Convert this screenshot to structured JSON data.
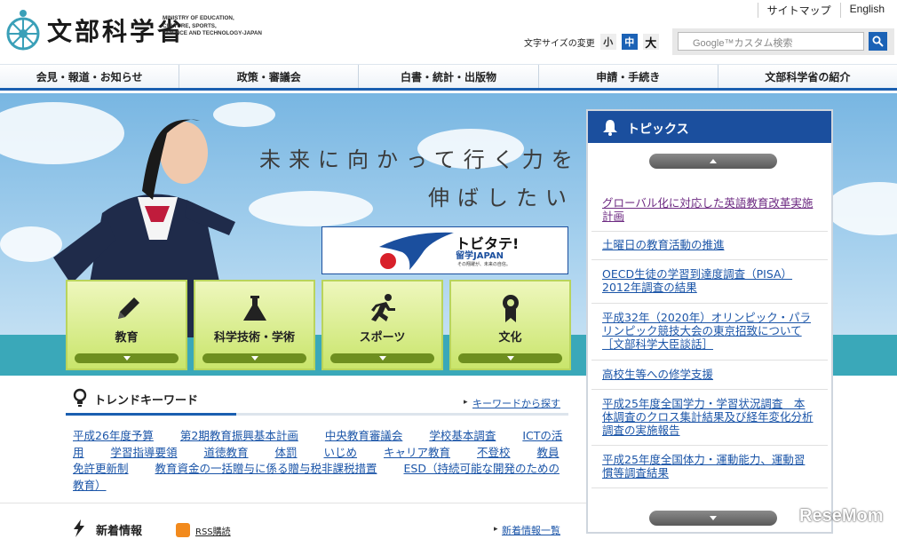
{
  "header": {
    "logo_text": "文部科学省",
    "logo_en": [
      "MINISTRY OF EDUCATION,",
      "CULTURE, SPORTS,",
      "SCIENCE AND TECHNOLOGY-JAPAN"
    ],
    "links": [
      "サイトマップ",
      "English"
    ],
    "font_size_label": "文字サイズの変更",
    "font_sizes": [
      "小",
      "中",
      "大"
    ],
    "search_placeholder": "Google™カスタム検索"
  },
  "nav": [
    "会見・報道・お知らせ",
    "政策・審議会",
    "白書・統計・出版物",
    "申請・手続き",
    "文部科学省の紹介"
  ],
  "hero": {
    "slogan_line1": "未来に向かって行く力を",
    "slogan_line2": "伸ばしたい",
    "banner_title": "トビタテ!",
    "banner_sub": "留学JAPAN",
    "banner_tag": "その翔躍が、未来の自信。"
  },
  "categories": [
    "教育",
    "科学技術・学術",
    "スポーツ",
    "文化"
  ],
  "trends": {
    "title": "トレンドキーワード",
    "more": "キーワードから探す",
    "keywords": [
      "平成26年度予算",
      "第2期教育振興基本計画",
      "中央教育審議会",
      "学校基本調査",
      "ICTの活用",
      "学習指導要領",
      "道徳教育",
      "体罰",
      "いじめ",
      "キャリア教育",
      "不登校",
      "教員免許更新制",
      "教育資金の一括贈与に係る贈与税非課税措置",
      "ESD（持続可能な開発のための教育）"
    ]
  },
  "news": {
    "title": "新着情報",
    "rss": "RSS購読",
    "more": "新着情報一覧"
  },
  "topics": {
    "title": "トピックス",
    "items": [
      "グローバル化に対応した英語教育改革実施計画",
      "土曜日の教育活動の推進",
      "OECD生徒の学習到達度調査（PISA）2012年調査の結果",
      "平成32年（2020年）オリンピック・パラリンピック競技大会の東京招致について［文部科学大臣談話］",
      "高校生等への修学支援",
      "平成25年度全国学力・学習状況調査　本体調査のクロス集計結果及び経年変化分析調査の実施報告",
      "平成25年度全国体力・運動能力、運動習慣等調査結果"
    ]
  },
  "watermark": "ReseMom",
  "colors": {
    "brand_blue": "#1b4f9e",
    "link_blue": "#1b55a8",
    "category_green": "#c9e56b"
  }
}
